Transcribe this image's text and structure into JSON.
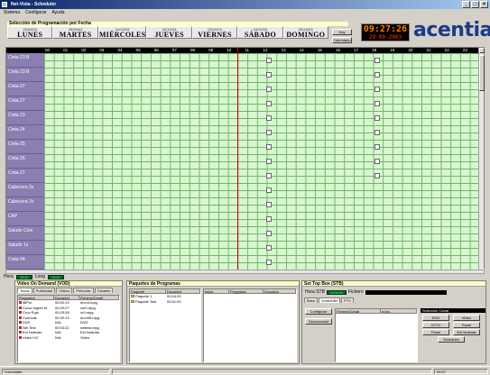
{
  "window": {
    "title": "Net-Vista - Scheduler",
    "min": "_",
    "max": "□",
    "close": "×"
  },
  "menu": [
    "Sistema",
    "Configurar",
    "Ayuda"
  ],
  "schedule": {
    "title": "Selección de Programación por Fecha",
    "days": [
      {
        "date": "25/09/03",
        "name": "LUNES"
      },
      {
        "date": "26/09/03",
        "name": "MARTES"
      },
      {
        "date": "01/10/03",
        "name": "MIÉRCOLES"
      },
      {
        "date": "02/10/03",
        "name": "JUEVES"
      },
      {
        "date": "03/10/03",
        "name": "VIERNES"
      },
      {
        "date": "04/10/03",
        "name": "SÁBADO"
      },
      {
        "date": "05/10/03",
        "name": "DOMINGO"
      }
    ],
    "hoy_label": "Hoy",
    "calendario_label": "Calendario",
    "clock_time": "09:27:26",
    "clock_date": "29-09-2003",
    "logo": "acentia"
  },
  "grid": {
    "hours": [
      "00",
      "01",
      "02",
      "03",
      "04",
      "05",
      "06",
      "07",
      "08",
      "09",
      "10",
      "11",
      "12",
      "13",
      "14",
      "15",
      "16",
      "17",
      "18",
      "19",
      "20",
      "21",
      "22",
      "23"
    ],
    "channels": [
      "Cinta 23 B",
      "Cinta 23 B",
      "Cinta 07",
      "Cinta 27",
      "Cinta 23",
      "Cinta 24",
      "Cinta 25",
      "Cinta 26",
      "Cinta 27",
      "Cabecera 2x",
      "Cabecera 2x",
      "CAP",
      "Saludo Cine",
      "Saludo 1x",
      "Cinta 04"
    ]
  },
  "status_strip": {
    "hora_label": "Hora",
    "hora_value": "00:00",
    "long_label": "Long",
    "long_value": "00:00"
  },
  "vod": {
    "title": "Video On Demand (VOD)",
    "tabs": [
      "Todos",
      "Publicidad",
      "Videos",
      "Películas",
      "Canales"
    ],
    "columns": [
      "Programa",
      "Duración",
      "Fichero/Canal"
    ],
    "rows": [
      [
        "MiPor",
        "00:00:13",
        "drvo4.mpg"
      ],
      [
        "Curso Inglés M.",
        "00:29:27",
        "cur0.mpg"
      ],
      [
        "Cruz Roja",
        "00:25:28",
        "cr0.mpg"
      ],
      [
        "Cuencas",
        "00:30:13",
        "drvo05.mpg"
      ],
      [
        "DVD",
        "N/A",
        "DVD"
      ],
      [
        "Net Test",
        "00:00:22",
        "nettest.mpg"
      ],
      [
        "Ext Noticias",
        "N/A",
        "Ext Noticias"
      ],
      [
        "Video IVC",
        "N/A",
        "Video"
      ]
    ]
  },
  "paquetes": {
    "title": "Paquetes de Programas",
    "columns": [
      "Paquete",
      "Duración"
    ],
    "rows": [
      [
        "Paquete 1",
        "00:04:33"
      ],
      [
        "Paquete Test",
        "00:01:00"
      ]
    ],
    "detail_columns": [
      "Inicio",
      "Programa",
      "Duración"
    ]
  },
  "stb": {
    "title": "Set Top Box (STB)",
    "hora_label": "Hora STB",
    "hora_value": "00:00:00",
    "fichero_label": "Fichero",
    "subtabs": [
      "Base",
      "Scheduler",
      "PTV"
    ],
    "configurar_label": "Configurar",
    "desconectar_label": "Desconectar",
    "list_columns": [
      "Fichero/Canal",
      "a las..."
    ],
    "canal_title": "Selección Canal",
    "canal_buttons": [
      "DVD",
      "Video",
      "CCTV",
      "Panel",
      "Panel",
      "Ext Noticias"
    ],
    "scheduler_btn": "Scheduler"
  },
  "statusbar": [
    "Conectado",
    "",
    "09:27"
  ]
}
